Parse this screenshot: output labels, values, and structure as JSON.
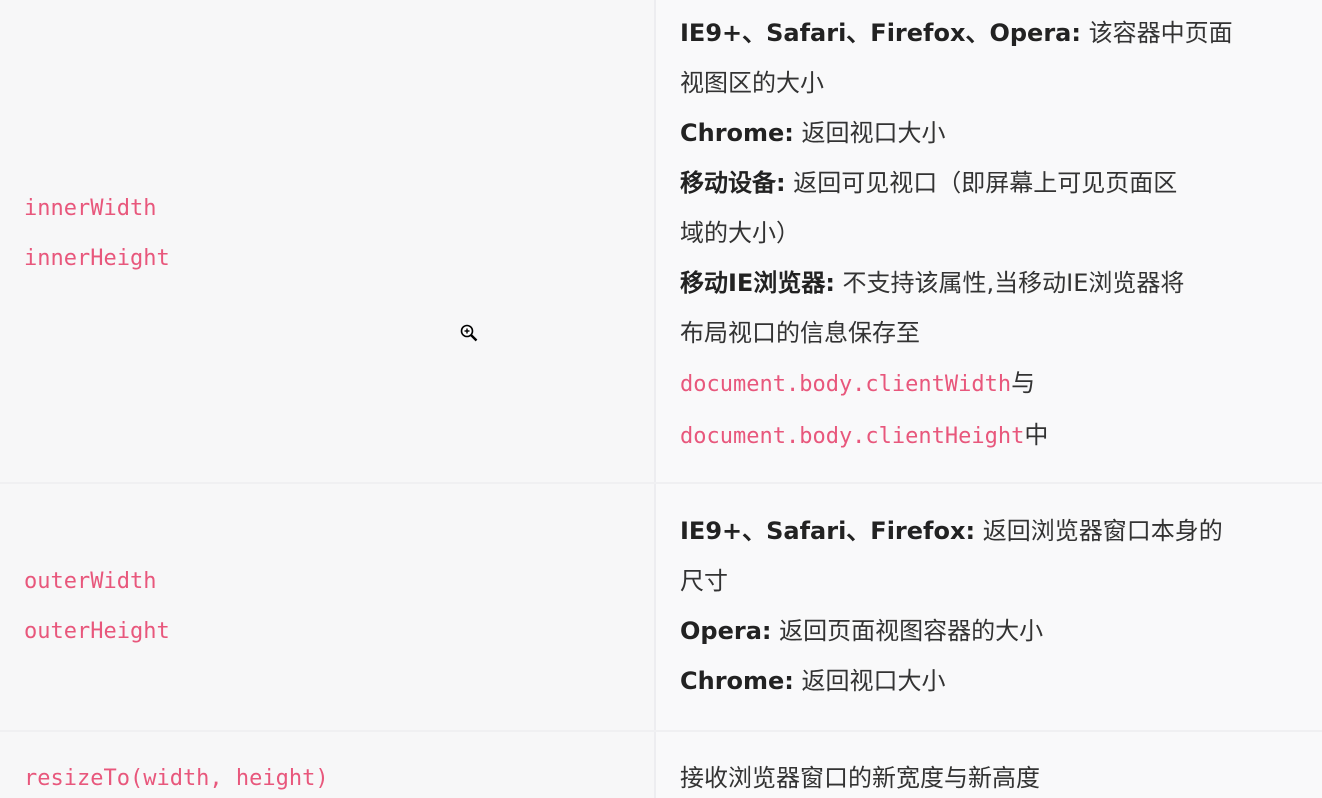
{
  "rows": [
    {
      "left": [
        "innerWidth",
        "innerHeight"
      ],
      "right": {
        "line1_bold": "IE9+、Safari、Firefox、Opera:",
        "line1_text": " 该容器中页面",
        "line2_text": "视图区的大小",
        "line3_bold": "Chrome:",
        "line3_text": " 返回视口大小",
        "line4_bold": "移动设备:",
        "line4_text": "  返回可见视口（即屏幕上可见页面区",
        "line5_text": "域的大小）",
        "line6_bold": "移动IE浏览器:",
        "line6_text": "  不支持该属性,当移动IE浏览器将",
        "line7_text": "布局视口的信息保存至",
        "line8_code": "document.body.clientWidth",
        "line8_text": "与",
        "line9_code": "document.body.clientHeight",
        "line9_text": "中"
      }
    },
    {
      "left": [
        "outerWidth",
        "outerHeight"
      ],
      "right": {
        "line1_bold": "IE9+、Safari、Firefox:",
        "line1_text": " 返回浏览器窗口本身的",
        "line2_text": "尺寸",
        "line3_bold": "Opera:",
        "line3_text": " 返回页面视图容器的大小",
        "line4_bold": "Chrome:",
        "line4_text": " 返回视口大小"
      }
    },
    {
      "left": [
        "resizeTo(width, height)"
      ],
      "right": {
        "line1_text": "接收浏览器窗口的新宽度与新高度"
      }
    }
  ],
  "cursor": {
    "icon": "zoom-in-icon"
  },
  "colors": {
    "code": "#e8577c",
    "text": "#333333",
    "left_bg": "#f7f7f8",
    "right_bg": "#f9f9fa",
    "border": "#ededf0"
  }
}
